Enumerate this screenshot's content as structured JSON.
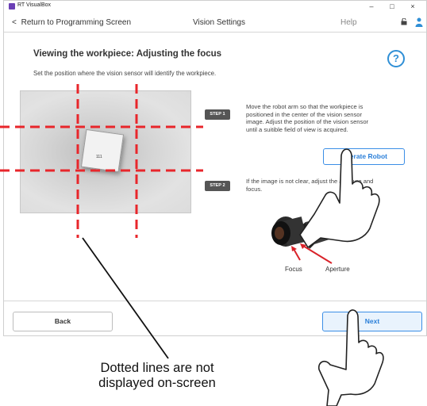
{
  "window": {
    "app_title": "RT VisualBox",
    "minimize_glyph": "–",
    "maximize_glyph": "□",
    "close_glyph": "×"
  },
  "nav": {
    "back_label": "Return to Programming Screen",
    "back_glyph": "<",
    "title": "Vision Settings",
    "help_label": "Help",
    "icons": [
      "lock-icon",
      "user-icon"
    ]
  },
  "content": {
    "heading": "Viewing the workpiece: Adjusting the focus",
    "help_glyph": "?",
    "subtext": "Set the position where the vision sensor will identify the workpiece.",
    "workpiece_mark": "111",
    "step1": {
      "badge": "STEP 1",
      "lines": [
        "Move the robot arm so that the workpiece is",
        "positioned in the center of the vision sensor",
        "image. Adjust the position of the vision sensor",
        "until a suitible field of view is acquired."
      ],
      "button_label": "Operate Robot"
    },
    "step2": {
      "badge": "STEP 2",
      "lines": [
        "If the image is not clear, adjust the aperture and",
        "focus."
      ]
    },
    "camera_labels": {
      "focus": "Focus",
      "aperture": "Aperture"
    }
  },
  "footer": {
    "back_label": "Back",
    "next_label": "Next"
  },
  "annotation": {
    "line1": "Dotted lines are not",
    "line2": "displayed on-screen"
  },
  "colors": {
    "accent": "#3b8ee6",
    "guide_red": "#e8262b",
    "badge": "#555555",
    "arrow_red": "#d9232a"
  }
}
